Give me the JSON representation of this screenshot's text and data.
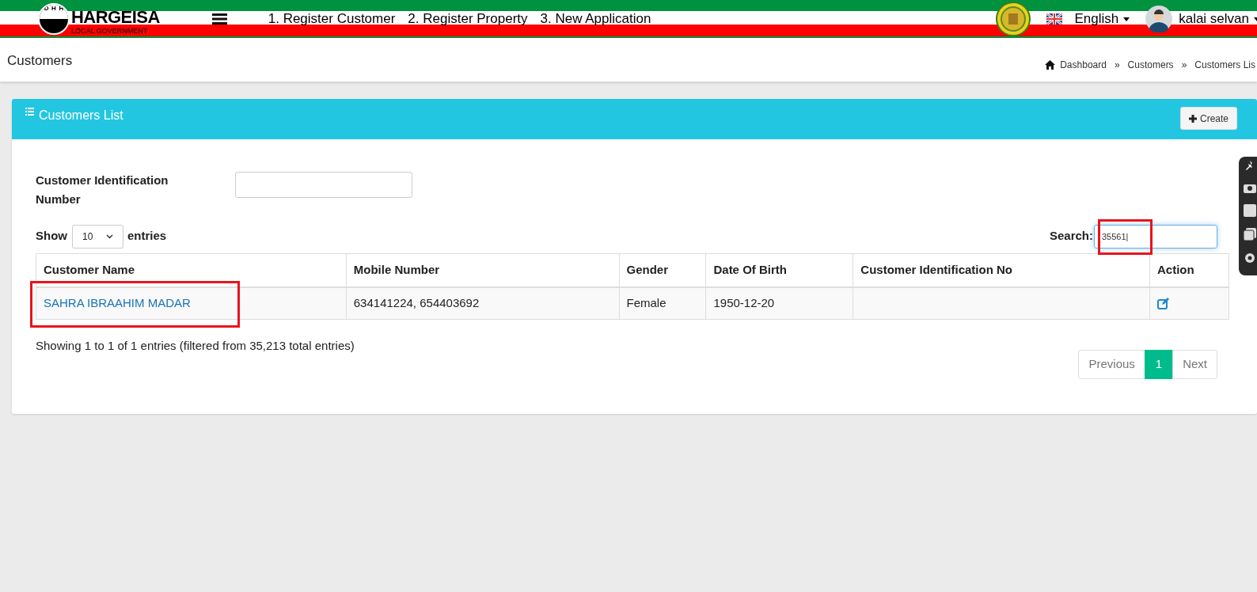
{
  "topbar": {
    "logo_title": "HARGEISA",
    "logo_subtitle": "LOCAL GOVERNMENT",
    "logo_letters": [
      "D",
      "H",
      "H"
    ],
    "nav_links": [
      "1. Register Customer",
      "2. Register Property",
      "3. New Application"
    ],
    "language": "English",
    "user": "kalai selvan"
  },
  "page_header": {
    "title": "Customers",
    "breadcrumb": [
      "Dashboard",
      "Customers",
      "Customers Lis"
    ],
    "breadcrumb_separator": "»"
  },
  "card": {
    "title": "Customers List",
    "create_button": "Create",
    "filter": {
      "label": "Customer Identification Number"
    },
    "length": {
      "prefix": "Show",
      "value": "10",
      "suffix": "entries"
    },
    "search": {
      "label": "Search:",
      "value": "35561|"
    },
    "table": {
      "columns": [
        "Customer Name",
        "Mobile Number",
        "Gender",
        "Date Of Birth",
        "Customer Identification No",
        "Action"
      ],
      "rows": [
        {
          "name": "SAHRA IBRAAHIM MADAR",
          "mobile": "634141224, 654403692",
          "gender": "Female",
          "dob": "1950-12-20",
          "cin": ""
        }
      ]
    },
    "info": "Showing 1 to 1 of 1 entries (filtered from 35,213 total entries)",
    "pagination": [
      {
        "label": "Previous",
        "kind": "prev",
        "selected": false
      },
      {
        "label": "1",
        "kind": "page",
        "selected": true
      },
      {
        "label": "Next",
        "kind": "next",
        "selected": false
      }
    ]
  }
}
